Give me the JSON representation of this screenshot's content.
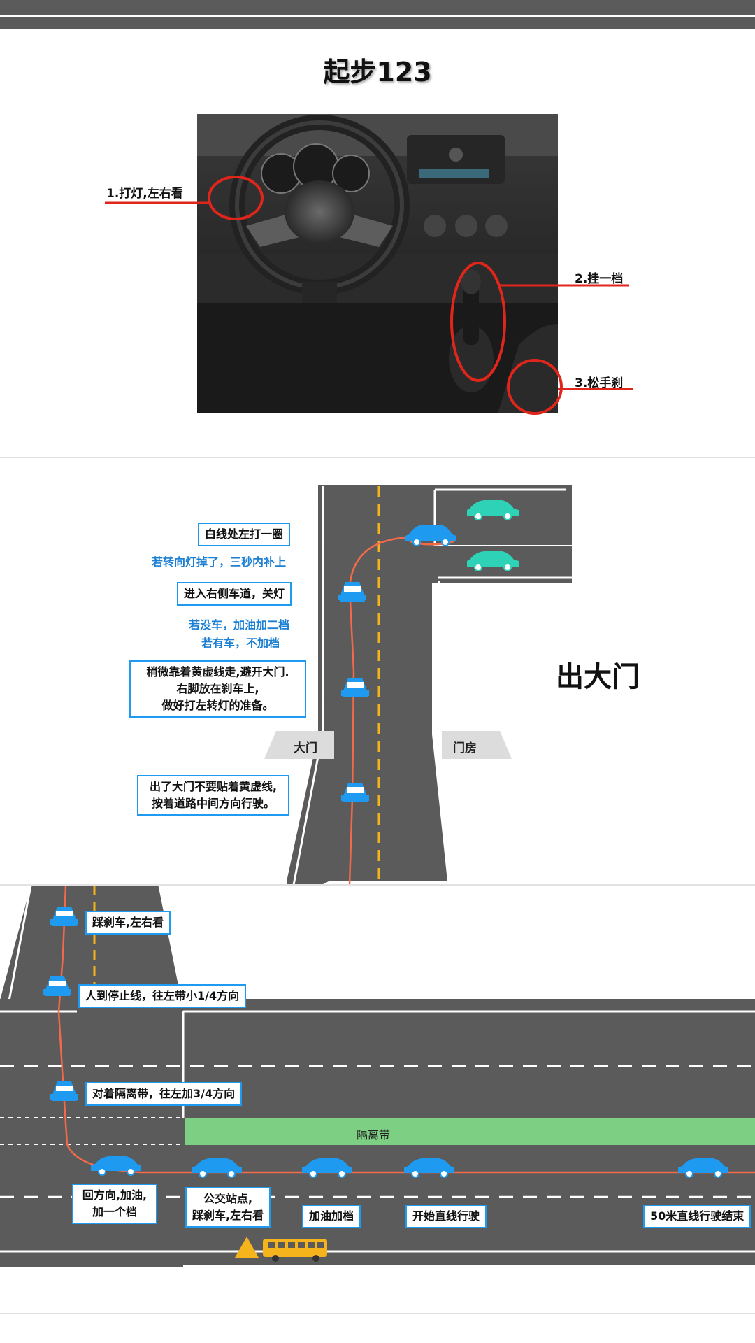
{
  "title": "起步123",
  "start_steps": {
    "step1": "1.打灯,左右看",
    "step2": "2.挂一档",
    "step3": "3.松手刹"
  },
  "exit_gate": {
    "heading": "出大门",
    "gate_label": "大门",
    "guardhouse_label": "门房",
    "boxes": {
      "circle_left": "白线处左打一圈",
      "enter_right_lane": "进入右侧车道，关灯",
      "keep_yellow_line": [
        "稍微靠着黄虚线走,避开大门.",
        "右脚放在刹车上,",
        "做好打左转灯的准备。"
      ],
      "after_gate": [
        "出了大门不要贴着黄虚线,",
        "按着道路中间方向行驶。"
      ]
    },
    "notes": {
      "signal_off": "若转向灯掉了，三秒内补上",
      "no_car": "若没车，加油加二档",
      "has_car": "若有车，不加档"
    }
  },
  "turn_left": {
    "boxes": {
      "brake_look": "踩刹车,左右看",
      "stop_line": "人到停止线，往左带小1/4方向",
      "median": "对着隔离带，往左加3/4方向",
      "return_wheel": [
        "回方向,加油,",
        "加一个档"
      ],
      "bus_stop": [
        "公交站点,",
        "踩刹车,左右看"
      ],
      "shift_up": "加油加档",
      "straight": "开始直线行驶",
      "end": "50米直线行驶结束"
    },
    "median_label": "隔离带"
  },
  "colors": {
    "road": "#5b5b5b",
    "blue_car": "#1e9bf0",
    "teal_car": "#2ed3b7",
    "path": "#f26a4b",
    "yellow_line": "#f5b31c",
    "median": "#7dd083",
    "red_callout": "#e0261b"
  },
  "icons": [
    "steering-wheel-icon",
    "car-icon",
    "bus-icon",
    "warning-triangle-icon"
  ]
}
